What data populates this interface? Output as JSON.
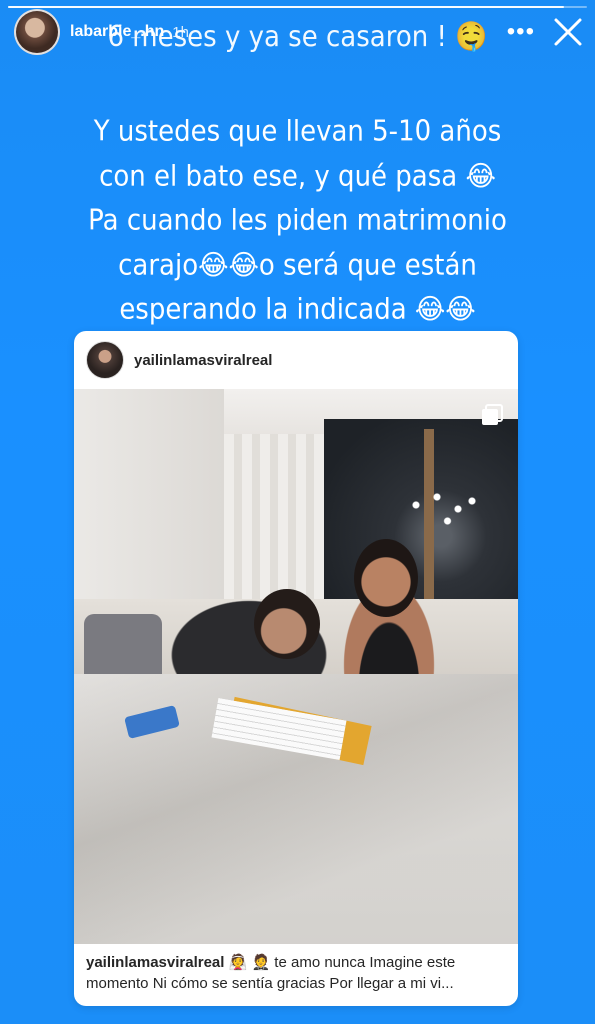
{
  "story": {
    "progress": 0.96,
    "header": {
      "username": "labarbie_.hn",
      "time": "1h"
    },
    "caption_top": "6 meses y ya se casaron ! 🤤",
    "caption_lines": [
      "Y ustedes que llevan 5-10 años",
      "con el bato ese, y qué pasa 😂",
      "Pa cuando les piden matrimonio",
      "carajo😂😂o será que están",
      "esperando la indicada 😂😂"
    ]
  },
  "post": {
    "username": "yailinlamasviralreal",
    "caption_user": "yailinlamasviralreal",
    "caption_line1_rest": "👰 🤵 te amo nunca Imagine este",
    "caption_line2": "momento Ni cómo se sentía gracias Por llegar a mi vi..."
  },
  "icons": {
    "more": "more-options-icon",
    "close": "close-icon",
    "carousel": "carousel-icon"
  },
  "colors": {
    "background": "#1a90ff"
  }
}
